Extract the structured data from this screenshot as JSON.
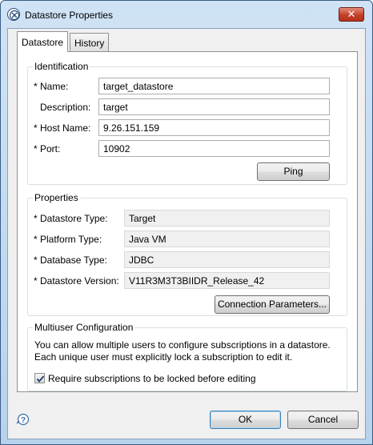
{
  "window": {
    "title": "Datastore Properties",
    "close_glyph": "✕"
  },
  "tabs": [
    {
      "label": "Datastore",
      "active": true
    },
    {
      "label": "History",
      "active": false
    }
  ],
  "identification": {
    "title": "Identification",
    "name_label": "* Name:",
    "name_value": "target_datastore",
    "description_label": "Description:",
    "description_value": "target",
    "host_label": "* Host Name:",
    "host_value": "9.26.151.159",
    "port_label": "* Port:",
    "port_value": "10902",
    "ping_label": "Ping"
  },
  "properties": {
    "title": "Properties",
    "datastore_type_label": "* Datastore Type:",
    "datastore_type_value": "Target",
    "platform_type_label": "* Platform Type:",
    "platform_type_value": "Java VM",
    "database_type_label": "* Database Type:",
    "database_type_value": "JDBC",
    "datastore_version_label": "* Datastore Version:",
    "datastore_version_value": "V11R3M3T3BIIDR_Release_42",
    "connection_params_label": "Connection Parameters..."
  },
  "multiuser": {
    "title": "Multiuser Configuration",
    "line1": "You can allow multiple users to configure subscriptions in a datastore.",
    "line2": "Each unique user must explicitly lock a subscription to edit it.",
    "checkbox_label": "Require subscriptions to be locked before editing",
    "checked": true
  },
  "footer": {
    "ok_label": "OK",
    "cancel_label": "Cancel"
  },
  "icons": {
    "app": "app-icon",
    "help": "help-icon",
    "close": "close-icon"
  },
  "colors": {
    "titlebar": "#c4daf0",
    "close_button": "#c4402a",
    "default_button_border": "#3c7fb1"
  }
}
